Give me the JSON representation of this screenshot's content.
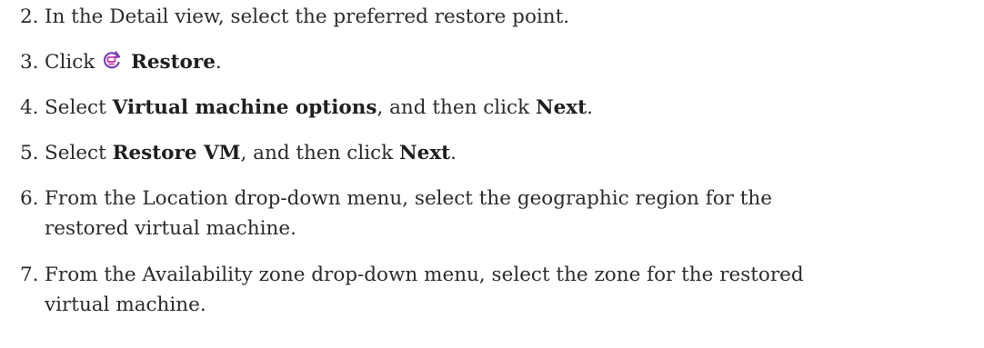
{
  "steps": [
    {
      "number": "2.",
      "text": "In the Detail view, select the preferred restore point."
    },
    {
      "number": "3.",
      "pre": "Click",
      "icon": "restore-icon",
      "bold1": "Restore",
      "post": "."
    },
    {
      "number": "4.",
      "pre": "Select",
      "bold1": "Virtual machine options",
      "mid": ", and then click",
      "bold2": "Next",
      "post": "."
    },
    {
      "number": "5.",
      "pre": "Select",
      "bold1": "Restore VM",
      "mid": ", and then click",
      "bold2": "Next",
      "post": "."
    },
    {
      "number": "6.",
      "line1": "From the Location drop-down menu, select the geographic region for the",
      "line2": "restored virtual machine."
    },
    {
      "number": "7.",
      "line1": "From the Availability zone drop-down menu, select the zone for the restored",
      "line2": "virtual machine."
    }
  ],
  "colors": {
    "text": "#2b2b2b",
    "icon_purple": "#7b3fb5",
    "icon_pink": "#c43aa8"
  }
}
